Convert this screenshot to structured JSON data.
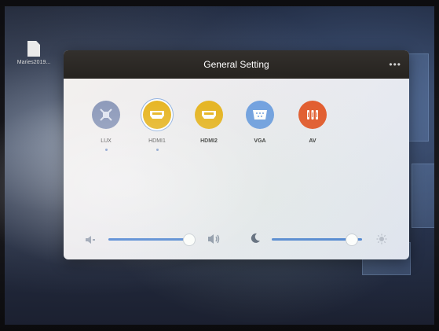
{
  "desktop": {
    "file_label": "Maries2019..."
  },
  "dialog": {
    "title": "General Setting",
    "menu_label": "•••"
  },
  "sources": [
    {
      "name": "LUX",
      "icon": "lux-icon",
      "color": "#8a97b8",
      "selected": false,
      "indicator": true,
      "bold": false
    },
    {
      "name": "HDMI1",
      "icon": "hdmi-icon",
      "color": "#e6b420",
      "selected": true,
      "indicator": true,
      "bold": false
    },
    {
      "name": "HDMI2",
      "icon": "hdmi-icon",
      "color": "#e6b420",
      "selected": false,
      "indicator": false,
      "bold": true
    },
    {
      "name": "VGA",
      "icon": "vga-icon",
      "color": "#6f9fe0",
      "selected": false,
      "indicator": false,
      "bold": true
    },
    {
      "name": "AV",
      "icon": "av-icon",
      "color": "#e25a2c",
      "selected": false,
      "indicator": false,
      "bold": true
    }
  ],
  "sliders": {
    "volume": {
      "level": 0.95,
      "icon_low": "volume-low-icon",
      "icon_high": "volume-high-icon"
    },
    "brightness": {
      "level": 0.88,
      "icon_low": "moon-icon",
      "icon_high": "sun-icon"
    }
  },
  "colors": {
    "accent": "#4f85d2",
    "titlebar": "#2b2825"
  }
}
